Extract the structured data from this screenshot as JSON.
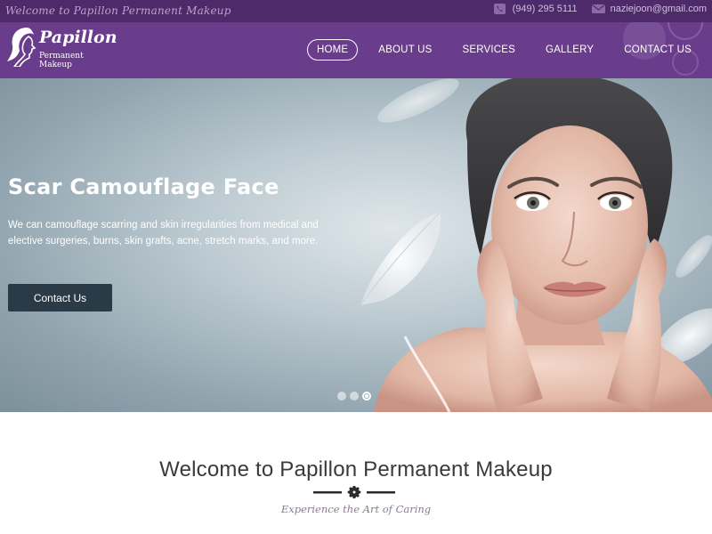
{
  "topbar": {
    "tagline": "Welcome to Papillon Permanent Makeup",
    "phone": "(949) 295 5111",
    "email": "naziejoon@gmail.com"
  },
  "logo": {
    "title": "Papillon",
    "subtitle": "Permanent Makeup"
  },
  "nav": {
    "items": [
      {
        "label": "HOME",
        "active": true
      },
      {
        "label": "ABOUT US",
        "active": false
      },
      {
        "label": "SERVICES",
        "active": false
      },
      {
        "label": "GALLERY",
        "active": false
      },
      {
        "label": "CONTACT US",
        "active": false
      }
    ]
  },
  "hero": {
    "title": "Scar Camouflage Face",
    "text": "We can camouflage scarring and skin irregularities from medical and elective surgeries, burns, skin grafts, acne, stretch marks, and more.",
    "button_label": "Contact Us",
    "slides_total": 3,
    "active_slide": 3
  },
  "welcome": {
    "title": "Welcome to Papillon Permanent Makeup",
    "subtitle": "Experience the Art of Caring"
  },
  "colors": {
    "topbar_bg": "#4f2a6b",
    "header_bg": "#6a3c8c",
    "button_bg": "#2a3a47"
  },
  "icons": {
    "phone": "phone-icon",
    "mail": "mail-icon",
    "divider": "flower-ornament-icon"
  }
}
